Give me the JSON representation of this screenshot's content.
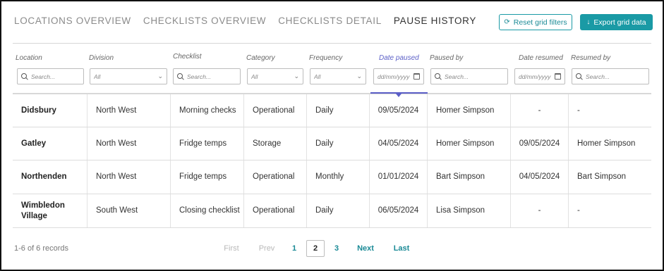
{
  "tabs": [
    {
      "label": "LOCATIONS OVERVIEW",
      "active": false
    },
    {
      "label": "CHECKLISTS OVERVIEW",
      "active": false
    },
    {
      "label": "CHECKLISTS DETAIL",
      "active": false
    },
    {
      "label": "PAUSE HISTORY",
      "active": true
    }
  ],
  "toolbar": {
    "reset_label": "Reset grid filters",
    "reset_icon": "refresh-icon",
    "export_label": "Export grid data",
    "export_icon": "download-arrow-icon"
  },
  "columns": [
    {
      "label": "Location",
      "filter": {
        "type": "search",
        "placeholder": "Search..."
      }
    },
    {
      "label": "Division",
      "filter": {
        "type": "select",
        "value": "All"
      }
    },
    {
      "label": "Checklist",
      "filter": {
        "type": "search",
        "placeholder": "Search..."
      }
    },
    {
      "label": "Category",
      "filter": {
        "type": "select",
        "value": "All"
      }
    },
    {
      "label": "Frequency",
      "filter": {
        "type": "select",
        "value": "All"
      }
    },
    {
      "label": "Date paused",
      "filter": {
        "type": "date",
        "placeholder": "dd/mm/yyyy"
      },
      "sorted": "descending"
    },
    {
      "label": "Paused by",
      "filter": {
        "type": "search",
        "placeholder": "Search..."
      }
    },
    {
      "label": "Date resumed",
      "filter": {
        "type": "date",
        "placeholder": "dd/mm/yyyy"
      }
    },
    {
      "label": "Resumed by",
      "filter": {
        "type": "search",
        "placeholder": "Search..."
      }
    }
  ],
  "rows": [
    {
      "location": "Didsbury",
      "division": "North West",
      "checklist": "Morning checks",
      "category": "Operational",
      "frequency": "Daily",
      "date_paused": "09/05/2024",
      "paused_by": "Homer Simpson",
      "date_resumed": "-",
      "resumed_by": "-"
    },
    {
      "location": "Gatley",
      "division": "North West",
      "checklist": "Fridge temps",
      "category": "Storage",
      "frequency": "Daily",
      "date_paused": "04/05/2024",
      "paused_by": "Homer Simpson",
      "date_resumed": "09/05/2024",
      "resumed_by": "Homer Simpson"
    },
    {
      "location": "Northenden",
      "division": "North West",
      "checklist": "Fridge temps",
      "category": "Operational",
      "frequency": "Monthly",
      "date_paused": "01/01/2024",
      "paused_by": "Bart Simpson",
      "date_resumed": "04/05/2024",
      "resumed_by": "Bart Simpson"
    },
    {
      "location": "Wimbledon Village",
      "division": "South West",
      "checklist": "Closing checklist",
      "category": "Operational",
      "frequency": "Daily",
      "date_paused": "06/05/2024",
      "paused_by": "Lisa Simpson",
      "date_resumed": "-",
      "resumed_by": "-"
    }
  ],
  "footer": {
    "records_text": "1-6 of 6 records",
    "pagination": {
      "first": "First",
      "prev": "Prev",
      "pages": [
        "1",
        "2",
        "3"
      ],
      "current_page": "2",
      "next": "Next",
      "last": "Last"
    }
  },
  "colors": {
    "accent_teal": "#1a9aa5",
    "sort_indicator": "#5b5fc7",
    "disabled_text": "#b9b9b9"
  }
}
